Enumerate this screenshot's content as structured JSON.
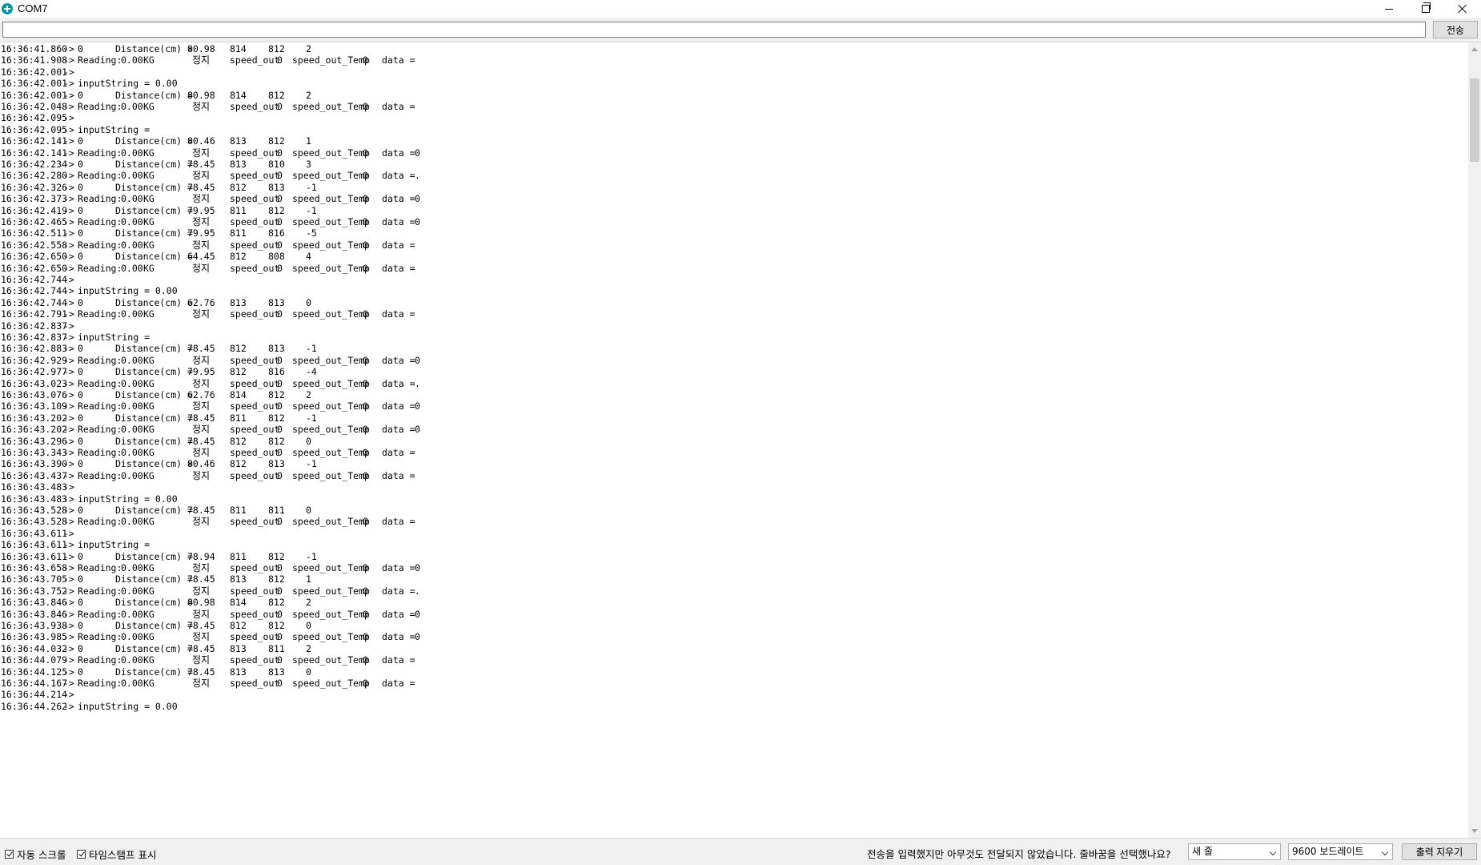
{
  "window": {
    "title": "COM7"
  },
  "send": {
    "input_value": "",
    "button_label": "전송"
  },
  "log": [
    {
      "ts": "16:36:41.860",
      "t": "dist",
      "v": "0",
      "d": "80.98",
      "a": "814",
      "b": "812",
      "c": "2"
    },
    {
      "ts": "16:36:41.908",
      "t": "read",
      "w": "0.00",
      "s": "정지",
      "so": "0",
      "st": "0",
      "data": ""
    },
    {
      "ts": "16:36:42.001",
      "t": "raw",
      "text": ""
    },
    {
      "ts": "16:36:42.001",
      "t": "raw",
      "text": "inputString = 0.00"
    },
    {
      "ts": "16:36:42.001",
      "t": "dist",
      "v": "0",
      "d": "80.98",
      "a": "814",
      "b": "812",
      "c": "2"
    },
    {
      "ts": "16:36:42.048",
      "t": "read",
      "w": "0.00",
      "s": "정지",
      "so": "0",
      "st": "0",
      "data": ""
    },
    {
      "ts": "16:36:42.095",
      "t": "raw",
      "text": ""
    },
    {
      "ts": "16:36:42.095",
      "t": "raw",
      "text": "inputString ="
    },
    {
      "ts": "16:36:42.141",
      "t": "dist",
      "v": "0",
      "d": "80.46",
      "a": "813",
      "b": "812",
      "c": "1"
    },
    {
      "ts": "16:36:42.141",
      "t": "read",
      "w": "0.00",
      "s": "정지",
      "so": "0",
      "st": "0",
      "data": "0"
    },
    {
      "ts": "16:36:42.234",
      "t": "dist",
      "v": "0",
      "d": "78.45",
      "a": "813",
      "b": "810",
      "c": "3"
    },
    {
      "ts": "16:36:42.280",
      "t": "read",
      "w": "0.00",
      "s": "정지",
      "so": "0",
      "st": "0",
      "data": "."
    },
    {
      "ts": "16:36:42.326",
      "t": "dist",
      "v": "0",
      "d": "78.45",
      "a": "812",
      "b": "813",
      "c": "-1"
    },
    {
      "ts": "16:36:42.373",
      "t": "read",
      "w": "0.00",
      "s": "정지",
      "so": "0",
      "st": "0",
      "data": "0"
    },
    {
      "ts": "16:36:42.419",
      "t": "dist",
      "v": "0",
      "d": "79.95",
      "a": "811",
      "b": "812",
      "c": "-1"
    },
    {
      "ts": "16:36:42.465",
      "t": "read",
      "w": "0.00",
      "s": "정지",
      "so": "0",
      "st": "0",
      "data": "0"
    },
    {
      "ts": "16:36:42.511",
      "t": "dist",
      "v": "0",
      "d": "79.95",
      "a": "811",
      "b": "816",
      "c": "-5"
    },
    {
      "ts": "16:36:42.558",
      "t": "read",
      "w": "0.00",
      "s": "정지",
      "so": "0",
      "st": "0",
      "data": ""
    },
    {
      "ts": "16:36:42.650",
      "t": "dist",
      "v": "0",
      "d": "64.45",
      "a": "812",
      "b": "808",
      "c": "4"
    },
    {
      "ts": "16:36:42.650",
      "t": "read",
      "w": "0.00",
      "s": "정지",
      "so": "0",
      "st": "0",
      "data": ""
    },
    {
      "ts": "16:36:42.744",
      "t": "raw",
      "text": ""
    },
    {
      "ts": "16:36:42.744",
      "t": "raw",
      "text": "inputString = 0.00"
    },
    {
      "ts": "16:36:42.744",
      "t": "dist",
      "v": "0",
      "d": "62.76",
      "a": "813",
      "b": "813",
      "c": "0"
    },
    {
      "ts": "16:36:42.791",
      "t": "read",
      "w": "0.00",
      "s": "정지",
      "so": "0",
      "st": "0",
      "data": ""
    },
    {
      "ts": "16:36:42.837",
      "t": "raw",
      "text": ""
    },
    {
      "ts": "16:36:42.837",
      "t": "raw",
      "text": "inputString ="
    },
    {
      "ts": "16:36:42.883",
      "t": "dist",
      "v": "0",
      "d": "78.45",
      "a": "812",
      "b": "813",
      "c": "-1"
    },
    {
      "ts": "16:36:42.929",
      "t": "read",
      "w": "0.00",
      "s": "정지",
      "so": "0",
      "st": "0",
      "data": "0"
    },
    {
      "ts": "16:36:42.977",
      "t": "dist",
      "v": "0",
      "d": "79.95",
      "a": "812",
      "b": "816",
      "c": "-4"
    },
    {
      "ts": "16:36:43.023",
      "t": "read",
      "w": "0.00",
      "s": "정지",
      "so": "0",
      "st": "0",
      "data": "."
    },
    {
      "ts": "16:36:43.076",
      "t": "dist",
      "v": "0",
      "d": "62.76",
      "a": "814",
      "b": "812",
      "c": "2"
    },
    {
      "ts": "16:36:43.109",
      "t": "read",
      "w": "0.00",
      "s": "정지",
      "so": "0",
      "st": "0",
      "data": "0"
    },
    {
      "ts": "16:36:43.202",
      "t": "dist",
      "v": "0",
      "d": "78.45",
      "a": "811",
      "b": "812",
      "c": "-1"
    },
    {
      "ts": "16:36:43.202",
      "t": "read",
      "w": "0.00",
      "s": "정지",
      "so": "0",
      "st": "0",
      "data": "0"
    },
    {
      "ts": "16:36:43.296",
      "t": "dist",
      "v": "0",
      "d": "78.45",
      "a": "812",
      "b": "812",
      "c": "0"
    },
    {
      "ts": "16:36:43.343",
      "t": "read",
      "w": "0.00",
      "s": "정지",
      "so": "0",
      "st": "0",
      "data": ""
    },
    {
      "ts": "16:36:43.390",
      "t": "dist",
      "v": "0",
      "d": "80.46",
      "a": "812",
      "b": "813",
      "c": "-1"
    },
    {
      "ts": "16:36:43.437",
      "t": "read",
      "w": "0.00",
      "s": "정지",
      "so": "0",
      "st": "0",
      "data": ""
    },
    {
      "ts": "16:36:43.483",
      "t": "raw",
      "text": ""
    },
    {
      "ts": "16:36:43.483",
      "t": "raw",
      "text": "inputString = 0.00"
    },
    {
      "ts": "16:36:43.528",
      "t": "dist",
      "v": "0",
      "d": "78.45",
      "a": "811",
      "b": "811",
      "c": "0"
    },
    {
      "ts": "16:36:43.528",
      "t": "read",
      "w": "0.00",
      "s": "정지",
      "so": "0",
      "st": "0",
      "data": ""
    },
    {
      "ts": "16:36:43.611",
      "t": "raw",
      "text": ""
    },
    {
      "ts": "16:36:43.611",
      "t": "raw",
      "text": "inputString ="
    },
    {
      "ts": "16:36:43.611",
      "t": "dist",
      "v": "0",
      "d": "78.94",
      "a": "811",
      "b": "812",
      "c": "-1"
    },
    {
      "ts": "16:36:43.658",
      "t": "read",
      "w": "0.00",
      "s": "정지",
      "so": "0",
      "st": "0",
      "data": "0"
    },
    {
      "ts": "16:36:43.705",
      "t": "dist",
      "v": "0",
      "d": "78.45",
      "a": "813",
      "b": "812",
      "c": "1"
    },
    {
      "ts": "16:36:43.752",
      "t": "read",
      "w": "0.00",
      "s": "정지",
      "so": "0",
      "st": "0",
      "data": "."
    },
    {
      "ts": "16:36:43.846",
      "t": "dist",
      "v": "0",
      "d": "80.98",
      "a": "814",
      "b": "812",
      "c": "2"
    },
    {
      "ts": "16:36:43.846",
      "t": "read",
      "w": "0.00",
      "s": "정지",
      "so": "0",
      "st": "0",
      "data": "0"
    },
    {
      "ts": "16:36:43.938",
      "t": "dist",
      "v": "0",
      "d": "78.45",
      "a": "812",
      "b": "812",
      "c": "0"
    },
    {
      "ts": "16:36:43.985",
      "t": "read",
      "w": "0.00",
      "s": "정지",
      "so": "0",
      "st": "0",
      "data": "0"
    },
    {
      "ts": "16:36:44.032",
      "t": "dist",
      "v": "0",
      "d": "78.45",
      "a": "813",
      "b": "811",
      "c": "2"
    },
    {
      "ts": "16:36:44.079",
      "t": "read",
      "w": "0.00",
      "s": "정지",
      "so": "0",
      "st": "0",
      "data": ""
    },
    {
      "ts": "16:36:44.125",
      "t": "dist",
      "v": "0",
      "d": "78.45",
      "a": "813",
      "b": "813",
      "c": "0"
    },
    {
      "ts": "16:36:44.167",
      "t": "read",
      "w": "0.00",
      "s": "정지",
      "so": "0",
      "st": "0",
      "data": ""
    },
    {
      "ts": "16:36:44.214",
      "t": "raw",
      "text": ""
    },
    {
      "ts": "16:36:44.262",
      "t": "raw",
      "text": "inputString = 0.00"
    }
  ],
  "statusbar": {
    "autoscroll_label": "자동 스크롤",
    "autoscroll_checked": true,
    "timestamp_label": "타임스탬프 표시",
    "timestamp_checked": true,
    "hint": "전송을 입력했지만 아무것도 전달되지 않았습니다. 줄바꿈을 선택했나요?",
    "line_ending": "새 줄",
    "baud_rate": "9600 보드레이트",
    "clear_label": "출력 지우기"
  }
}
